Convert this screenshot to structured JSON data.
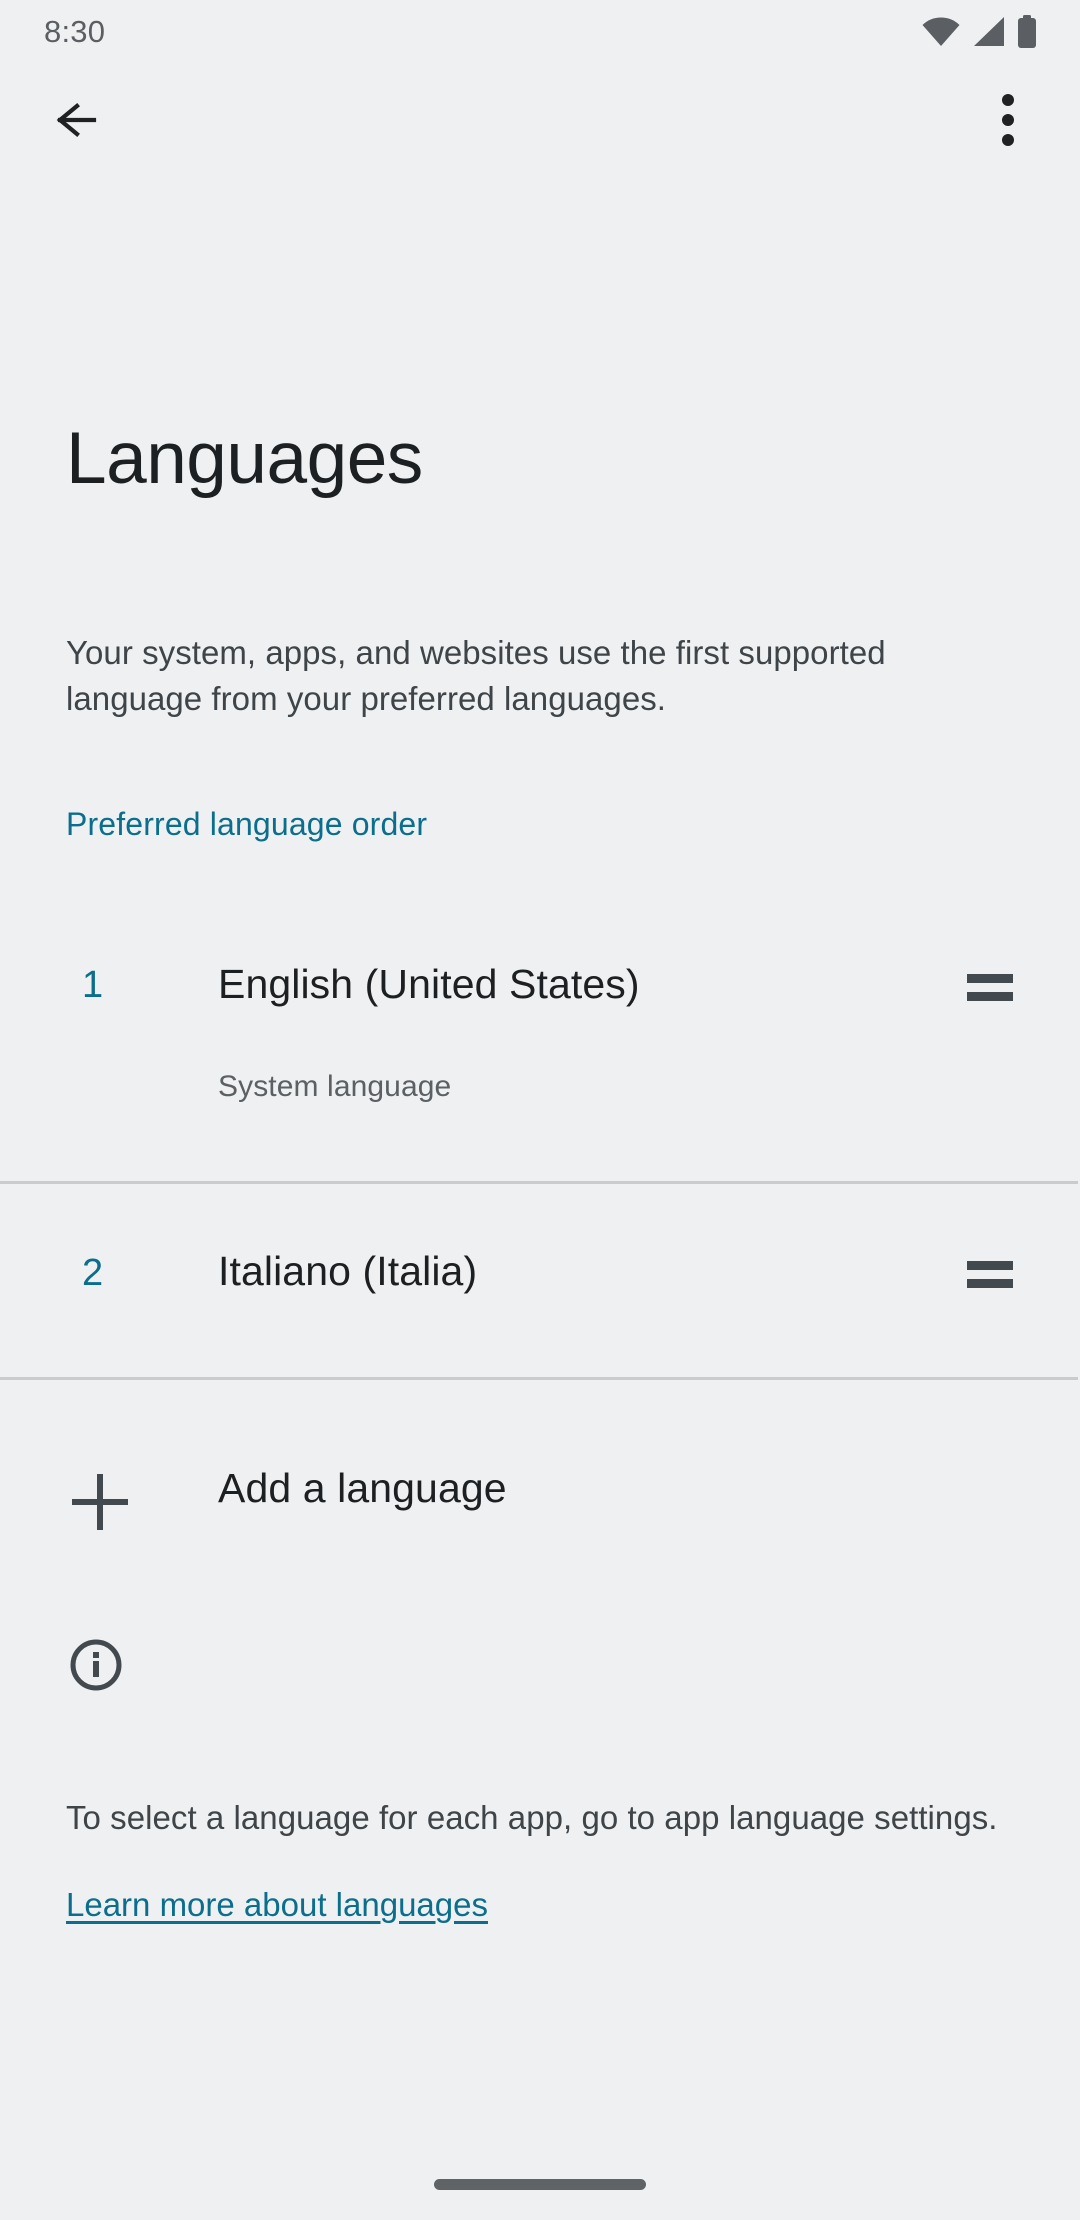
{
  "status_bar": {
    "time": "8:30",
    "icons": [
      "wifi-icon",
      "cell-signal-icon",
      "battery-icon"
    ]
  },
  "app_bar": {
    "back_icon": "back-arrow-icon",
    "overflow_icon": "more-options-icon"
  },
  "page": {
    "title": "Languages",
    "intro": "Your system, apps, and websites use the first supported language from your preferred languages."
  },
  "section": {
    "header": "Preferred language order"
  },
  "languages": [
    {
      "index": "1",
      "name": "English (United States)",
      "subtitle": "System language",
      "drag_icon": "drag-handle-icon"
    },
    {
      "index": "2",
      "name": "Italiano (Italia)",
      "subtitle": "",
      "drag_icon": "drag-handle-icon"
    }
  ],
  "add_language": {
    "label": "Add a language",
    "icon": "plus-icon"
  },
  "footer": {
    "icon": "info-icon",
    "text": "To select a language for each app, go to app language settings.",
    "link": "Learn more about languages"
  },
  "colors": {
    "background": "#eff0f1",
    "accent": "#0b6e8c",
    "primary_text": "#1d2022",
    "secondary_text": "#3f4448",
    "divider": "#c9cbcd",
    "icon": "#424a50"
  }
}
